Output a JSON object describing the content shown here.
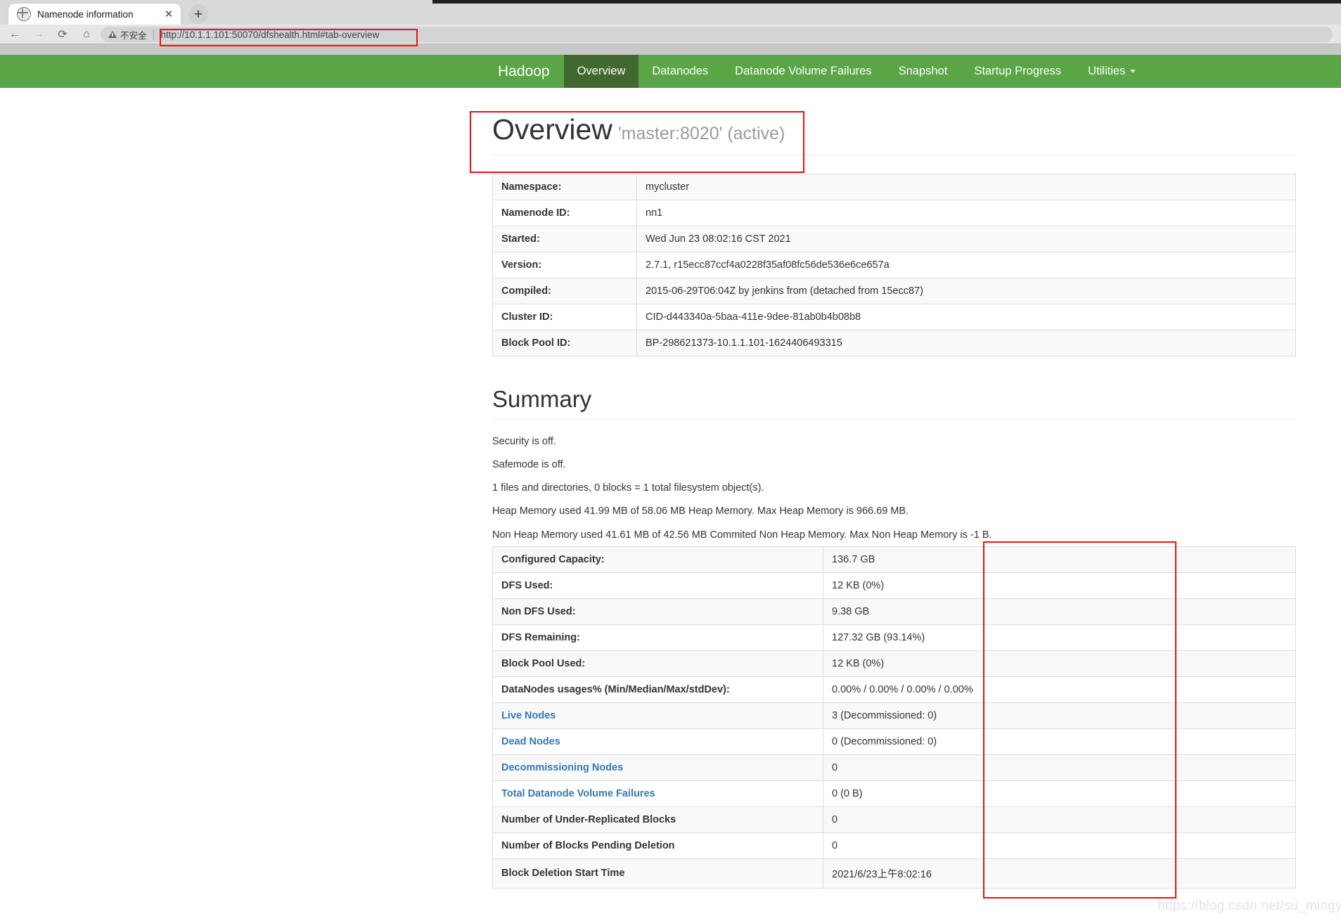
{
  "browser": {
    "tab_title": "Namenode information",
    "tab_close_label": "✕",
    "new_tab_label": "+",
    "back_label": "←",
    "forward_label": "→",
    "reload_label": "⟳",
    "home_label": "⌂",
    "security_label": "不安全",
    "url": "http://10.1.1.101:50070/dfshealth.html#tab-overview"
  },
  "navbar": {
    "brand": "Hadoop",
    "items": [
      {
        "label": "Overview",
        "active": true
      },
      {
        "label": "Datanodes",
        "active": false
      },
      {
        "label": "Datanode Volume Failures",
        "active": false
      },
      {
        "label": "Snapshot",
        "active": false
      },
      {
        "label": "Startup Progress",
        "active": false
      },
      {
        "label": "Utilities",
        "active": false,
        "caret": true
      }
    ]
  },
  "overview": {
    "title": "Overview",
    "subtitle": "'master:8020' (active)",
    "rows": [
      {
        "key": "Namespace:",
        "value": "mycluster"
      },
      {
        "key": "Namenode ID:",
        "value": "nn1"
      },
      {
        "key": "Started:",
        "value": "Wed Jun 23 08:02:16 CST 2021"
      },
      {
        "key": "Version:",
        "value": "2.7.1, r15ecc87ccf4a0228f35af08fc56de536e6ce657a"
      },
      {
        "key": "Compiled:",
        "value": "2015-06-29T06:04Z by jenkins from (detached from 15ecc87)"
      },
      {
        "key": "Cluster ID:",
        "value": "CID-d443340a-5baa-411e-9dee-81ab0b4b08b8"
      },
      {
        "key": "Block Pool ID:",
        "value": "BP-298621373-10.1.1.101-1624406493315"
      }
    ]
  },
  "summary": {
    "title": "Summary",
    "lines": [
      "Security is off.",
      "Safemode is off.",
      "1 files and directories, 0 blocks = 1 total filesystem object(s).",
      "Heap Memory used 41.99 MB of 58.06 MB Heap Memory. Max Heap Memory is 966.69 MB.",
      "Non Heap Memory used 41.61 MB of 42.56 MB Commited Non Heap Memory. Max Non Heap Memory is -1 B."
    ],
    "rows": [
      {
        "key": "Configured Capacity:",
        "value": "136.7 GB",
        "link": false
      },
      {
        "key": "DFS Used:",
        "value": "12 KB (0%)",
        "link": false
      },
      {
        "key": "Non DFS Used:",
        "value": "9.38 GB",
        "link": false
      },
      {
        "key": "DFS Remaining:",
        "value": "127.32 GB (93.14%)",
        "link": false
      },
      {
        "key": "Block Pool Used:",
        "value": "12 KB (0%)",
        "link": false
      },
      {
        "key": "DataNodes usages% (Min/Median/Max/stdDev):",
        "value": "0.00% / 0.00% / 0.00% / 0.00%",
        "link": false
      },
      {
        "key": "Live Nodes",
        "value": "3 (Decommissioned: 0)",
        "link": true
      },
      {
        "key": "Dead Nodes",
        "value": "0 (Decommissioned: 0)",
        "link": true
      },
      {
        "key": "Decommissioning Nodes",
        "value": "0",
        "link": true
      },
      {
        "key": "Total Datanode Volume Failures",
        "value": "0 (0 B)",
        "link": true
      },
      {
        "key": "Number of Under-Replicated Blocks",
        "value": "0",
        "link": false
      },
      {
        "key": "Number of Blocks Pending Deletion",
        "value": "0",
        "link": false
      },
      {
        "key": "Block Deletion Start Time",
        "value": "2021/6/23上午8:02:16",
        "link": false
      }
    ]
  },
  "annotations": {
    "highlight_color": "#ee1111",
    "watermark": "https://blog.csdn.net/su_mingyang"
  }
}
